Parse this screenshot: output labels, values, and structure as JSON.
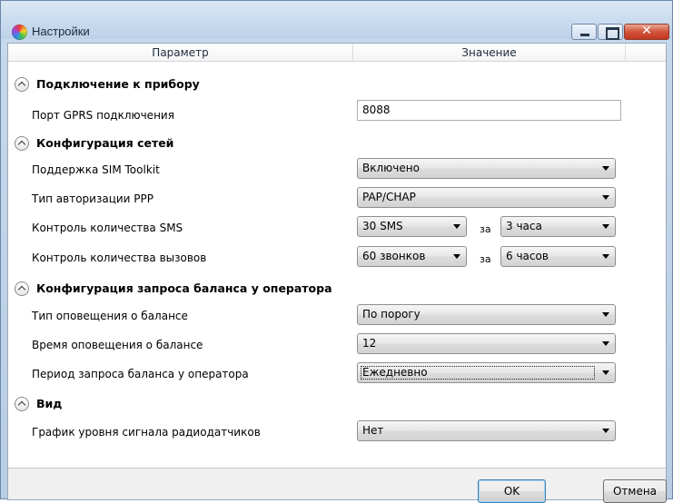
{
  "window": {
    "title": "Настройки",
    "close_glyph": "✕",
    "icons": {
      "app": "app-logo-icon",
      "minimize": "minimize-icon",
      "maximize": "maximize-icon",
      "close": "close-icon"
    }
  },
  "grid": {
    "headers": {
      "param": "Параметр",
      "value": "Значение"
    },
    "groups": [
      {
        "title": "Подключение к прибору"
      },
      {
        "title": "Конфигурация сетей"
      },
      {
        "title": "Конфигурация запроса баланса у оператора"
      },
      {
        "title": "Вид"
      }
    ],
    "rows": {
      "gprs_port": {
        "label": "Порт GPRS подключения",
        "value": "8088"
      },
      "sim_toolkit": {
        "label": "Поддержка SIM Toolkit",
        "value": "Включено"
      },
      "ppp_auth": {
        "label": "Тип авторизации PPP",
        "value": "PAP/CHAP"
      },
      "sms_control": {
        "label": "Контроль количества SMS",
        "count": "30 SMS",
        "za": "за",
        "period": "3 часа"
      },
      "calls_control": {
        "label": "Контроль количества вызовов",
        "count": "60 звонков",
        "za": "за",
        "period": "6 часов"
      },
      "balance_notify_type": {
        "label": "Тип оповещения о балансе",
        "value": "По порогу"
      },
      "balance_notify_time": {
        "label": "Время оповещения о балансе",
        "value": "12"
      },
      "balance_request_period": {
        "label": "Период запроса баланса у оператора",
        "value": "Ежедневно"
      },
      "radio_signal_graph": {
        "label": "График уровня сигнала радиодатчиков",
        "value": "Нет"
      }
    }
  },
  "buttons": {
    "ok": "OK",
    "cancel": "Отмена"
  },
  "colors": {
    "title_gradient_top": "#dbe7f4",
    "close_button": "#c2371f",
    "ok_border": "#3c7fb1"
  }
}
